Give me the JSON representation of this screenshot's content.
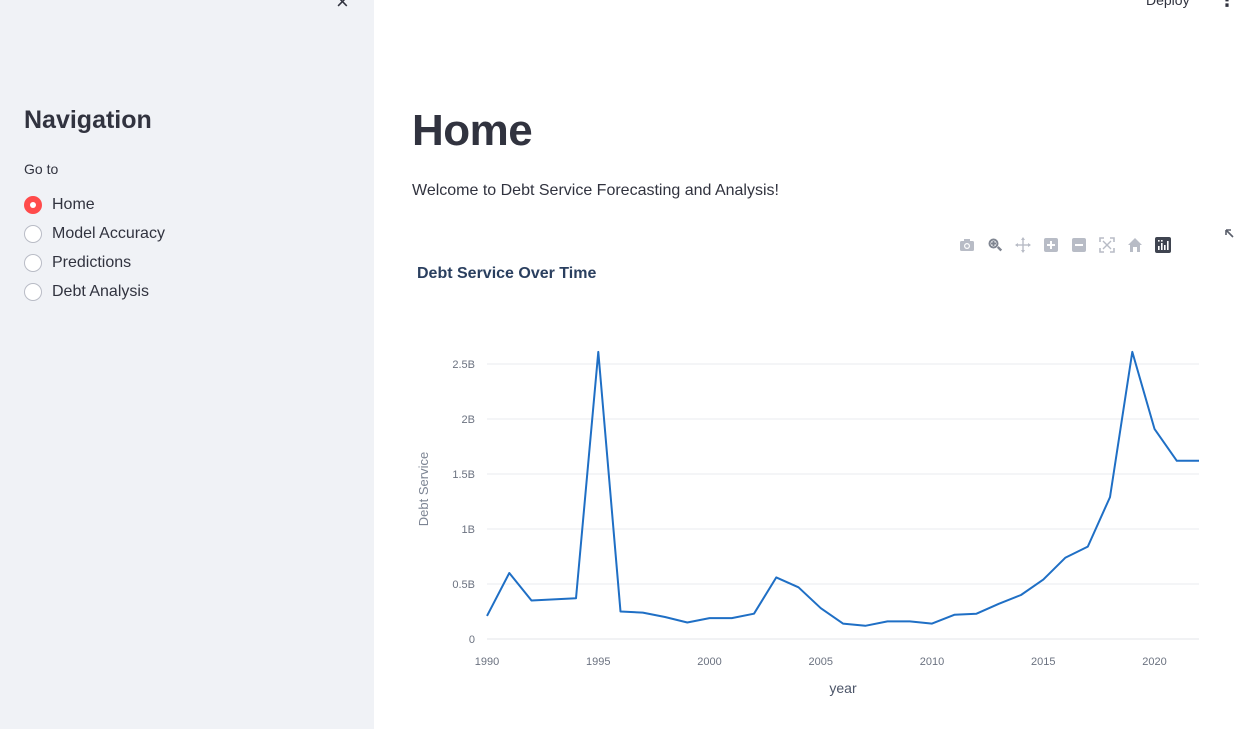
{
  "sidebar": {
    "close_label": "×",
    "title": "Navigation",
    "radio_label": "Go to",
    "options": [
      "Home",
      "Model Accuracy",
      "Predictions",
      "Debt Analysis"
    ],
    "selected": "Home"
  },
  "topbar": {
    "deploy_label": "Deploy",
    "menu_label": "⋮"
  },
  "main": {
    "title": "Home",
    "welcome": "Welcome to Debt Service Forecasting and Analysis!"
  },
  "modebar": {
    "icons": [
      "camera-icon",
      "zoom-icon",
      "pan-icon",
      "zoom-in-icon",
      "zoom-out-icon",
      "autoscale-icon",
      "reset-axes-icon",
      "plotly-logo-icon"
    ]
  },
  "colors": {
    "accent": "#ff4b4b",
    "line": "#1f6fc5",
    "sidebar_bg": "#f0f2f6"
  },
  "chart_data": {
    "type": "line",
    "title": "Debt Service Over Time",
    "xlabel": "year",
    "ylabel": "Debt Service",
    "xlim": [
      1990,
      2022
    ],
    "ylim": [
      0,
      2.6
    ],
    "x_ticks": [
      "1990",
      "1995",
      "2000",
      "2005",
      "2010",
      "2015",
      "2020"
    ],
    "y_ticks": [
      "0",
      "0.5B",
      "1B",
      "1.5B",
      "2B",
      "2.5B"
    ],
    "grid": true,
    "series": [
      {
        "x": [
          1990,
          1991,
          1992,
          1993,
          1994,
          1995,
          1996,
          1997,
          1998,
          1999,
          2000,
          2001,
          2002,
          2003,
          2004,
          2005,
          2006,
          2007,
          2008,
          2009,
          2010,
          2011,
          2012,
          2013,
          2014,
          2015,
          2016,
          2017,
          2018,
          2019,
          2020,
          2021,
          2022
        ],
        "values": [
          0.21,
          0.6,
          0.35,
          0.36,
          0.37,
          2.61,
          0.25,
          0.24,
          0.2,
          0.15,
          0.19,
          0.19,
          0.23,
          0.56,
          0.47,
          0.28,
          0.14,
          0.12,
          0.16,
          0.16,
          0.14,
          0.22,
          0.23,
          0.32,
          0.4,
          0.54,
          0.74,
          0.84,
          1.29,
          2.61,
          1.91,
          1.62,
          1.62
        ]
      }
    ]
  }
}
